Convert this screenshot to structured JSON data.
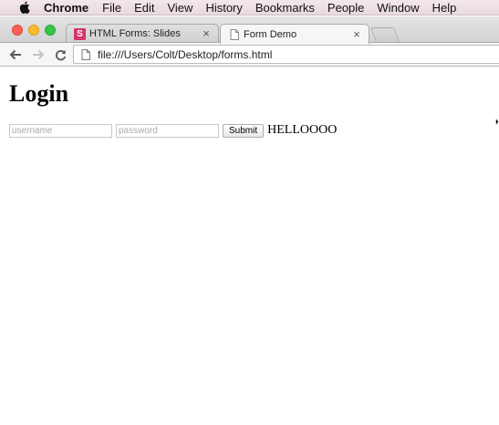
{
  "menubar": {
    "app_name": "Chrome",
    "items": [
      "File",
      "Edit",
      "View",
      "History",
      "Bookmarks",
      "People",
      "Window",
      "Help"
    ]
  },
  "tabs": [
    {
      "title": "HTML Forms: Slides",
      "favicon": "S",
      "active": false,
      "close": "×"
    },
    {
      "title": "Form Demo",
      "favicon": "page-icon",
      "active": true,
      "close": "×"
    }
  ],
  "toolbar": {
    "url": "file:///Users/Colt/Desktop/forms.html"
  },
  "page": {
    "heading": "Login",
    "form": {
      "username_placeholder": "username",
      "password_placeholder": "password",
      "submit_label": "Submit"
    },
    "message": "HELLOOOO"
  },
  "colors": {
    "traffic_red": "#fc5f57",
    "traffic_yellow": "#fdbb2e",
    "traffic_green": "#33c748",
    "slides_favicon": "#d6366a"
  }
}
